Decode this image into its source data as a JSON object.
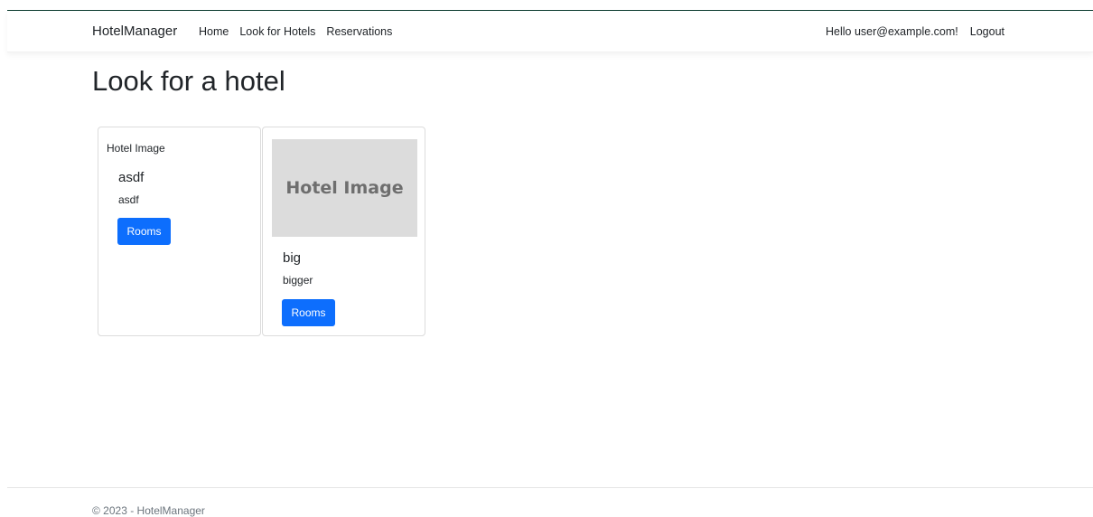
{
  "navbar": {
    "brand": "HotelManager",
    "links": [
      "Home",
      "Look for Hotels",
      "Reservations"
    ],
    "greeting": "Hello user@example.com!",
    "logout": "Logout"
  },
  "page": {
    "title": "Look for a hotel"
  },
  "hotels": [
    {
      "image_alt": "Hotel Image",
      "image_broken": true,
      "name": "asdf",
      "description": "asdf",
      "button_label": "Rooms"
    },
    {
      "image_text": "Hotel Image",
      "image_broken": false,
      "name": "big",
      "description": "bigger",
      "button_label": "Rooms"
    }
  ],
  "footer": {
    "text": "© 2023 - HotelManager"
  },
  "colors": {
    "primary": "#0d6efd",
    "placeholder_bg": "#dcdcdc",
    "placeholder_text": "#6e6e6e"
  }
}
